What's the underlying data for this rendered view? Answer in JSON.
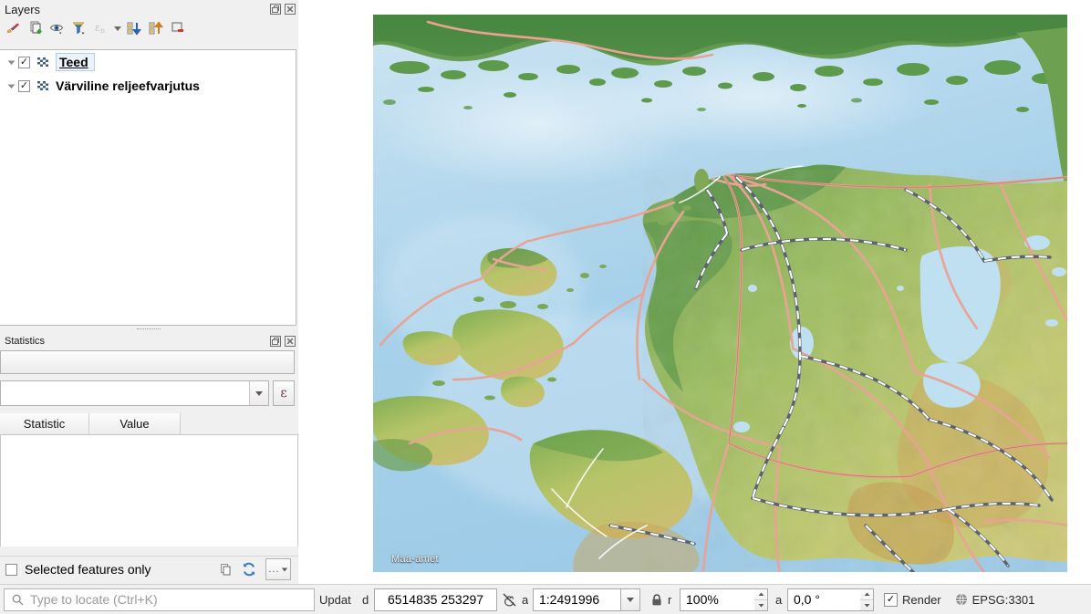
{
  "panels": {
    "layers": {
      "title": "Layers",
      "float_icon": "restore-icon",
      "close_icon": "close-icon",
      "toolbar": [
        {
          "name": "open-layer-styling-panel",
          "icon": "paintbrush-icon",
          "tip": "Open the Layer Styling panel"
        },
        {
          "name": "add-group",
          "icon": "add-group-icon",
          "tip": "Add Group"
        },
        {
          "name": "manage-map-themes",
          "icon": "eye-icon",
          "tip": "Manage Map Themes"
        },
        {
          "name": "filter-legend-by-map-content",
          "icon": "funnel-icon",
          "tip": "Filter Legend by Map Content"
        },
        {
          "name": "filter-legend-by-expression",
          "icon": "epsilon-icon",
          "tip": "Filter Legend by Expression"
        },
        {
          "name": "expand-all",
          "icon": "expand-all-icon",
          "tip": "Expand All"
        },
        {
          "name": "collapse-all",
          "icon": "collapse-all-icon",
          "tip": "Collapse All"
        },
        {
          "name": "remove-layer-or-group",
          "icon": "remove-layer-icon",
          "tip": "Remove Layer/Group"
        }
      ],
      "items": [
        {
          "label": "Teed",
          "checked": true,
          "selected": true,
          "expanded": true,
          "icon": "raster-layer-icon"
        },
        {
          "label": "Värviline reljeefvarjutus",
          "checked": true,
          "selected": false,
          "expanded": true,
          "icon": "raster-layer-icon"
        }
      ]
    },
    "statistics": {
      "title": "Statistics",
      "float_icon": "restore-icon",
      "close_icon": "close-icon",
      "layer_combo_value": "",
      "field_combo_value": "",
      "expression_button": "ε",
      "columns": [
        "Statistic",
        "Value"
      ],
      "rows": [],
      "selected_features_only": {
        "label": "Selected features only",
        "checked": false
      },
      "copy_icon": "copy-icon",
      "refresh_icon": "refresh-icon",
      "more_button": "..."
    }
  },
  "map": {
    "attribution": "Maa-amet",
    "background_color": "#a9d2ea"
  },
  "statusbar": {
    "locator_placeholder": "Type to locate (Ctrl+K)",
    "search_icon": "search-icon",
    "message_label": "Updat",
    "coordinate_label": "d",
    "coordinate_value": "6514835  253297",
    "extents_toggle_icon": "toggle-extents-icon",
    "scale_label": "a",
    "scale_value": "1:2491996",
    "lock_icon": "lock-icon",
    "magnifier_label": "r",
    "magnifier_value": "100%",
    "rotation_label": "a",
    "rotation_value": "0,0 °",
    "render_label": "Render",
    "render_checked": true,
    "crs_icon": "globe-icon",
    "crs_label": "EPSG:3301"
  }
}
